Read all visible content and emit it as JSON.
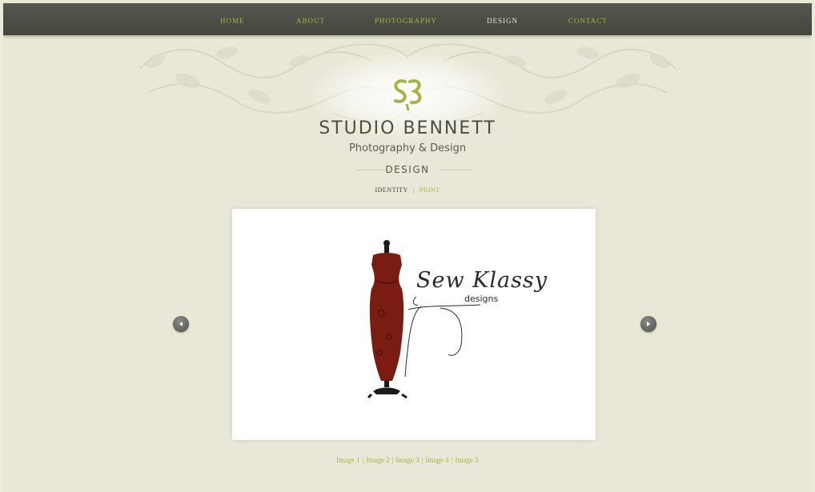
{
  "nav": {
    "items": [
      {
        "label": "HOME",
        "active": false
      },
      {
        "label": "ABOUT",
        "active": false
      },
      {
        "label": "PHOTOGRAPHY",
        "active": false
      },
      {
        "label": "DESIGN",
        "active": true
      },
      {
        "label": "CONTACT",
        "active": false
      }
    ]
  },
  "brand": {
    "title": "STUDIO BENNETT",
    "subtitle": "Photography & Design"
  },
  "section": {
    "heading": "DESIGN"
  },
  "subnav": {
    "identity": "IDENTITY",
    "separator": "|",
    "print": "PRINT"
  },
  "artwork": {
    "script": "Sew Klassy",
    "designs": "designs"
  },
  "image_links": [
    "Image 1",
    "Image 2",
    "Image 3",
    "Image 4",
    "Image 5"
  ],
  "colors": {
    "accent": "#a9b440",
    "nav_bg": "#4c4e46",
    "page_bg": "#e9e8d8",
    "dress": "#7a1c12"
  },
  "icons": {
    "prev": "chevron-left-icon",
    "next": "chevron-right-icon",
    "logo": "sb-monogram-icon"
  }
}
